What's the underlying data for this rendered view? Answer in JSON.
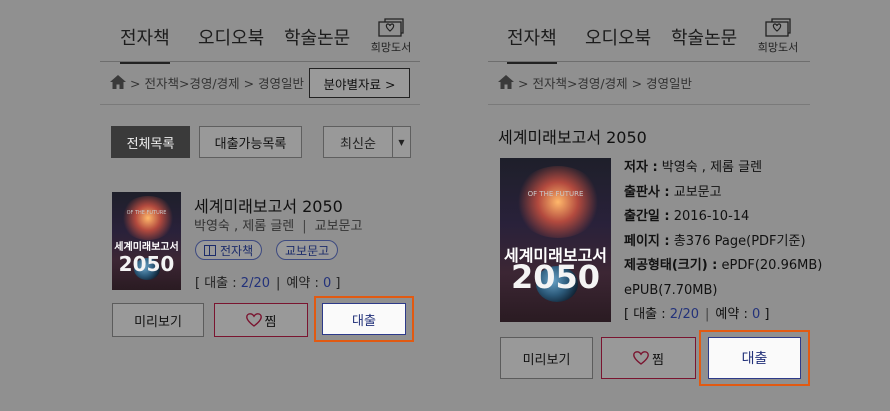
{
  "tabs": [
    "전자책",
    "오디오북",
    "학술논문"
  ],
  "wishlist_label": "희망도서",
  "breadcrumb": [
    "전자책",
    "경영/경제",
    "경영일반"
  ],
  "breadcrumb_text": "> 전자책>경영/경제 > 경영일반",
  "field_button": "분야별자료 >",
  "list_filters": {
    "all": "전체목록",
    "available": "대출가능목록",
    "sort": "최신순"
  },
  "book": {
    "title": "세계미래보고서 2050",
    "authors": "박영숙 , 제롬 글렌",
    "publisher": "교보문고",
    "tag_type": "전자책",
    "tag_publisher": "교보문고",
    "loan_label": "대출 : ",
    "loan_value": "2/20",
    "reserve_label": "예약 : ",
    "reserve_value": "0",
    "pub_date": "2016-10-14",
    "pages": "총376 Page(PDF기준)",
    "format": "ePDF(20.96MB)",
    "format2": "ePUB(7.70MB)",
    "cover_title": "세계미래보고서",
    "cover_year": "2050",
    "cover_sub": "OF THE FUTURE"
  },
  "detail_labels": {
    "author": "저자 :",
    "publisher": "출판사 :",
    "date": "출간일 :",
    "pages": "페이지 :",
    "format": "제공형태(크기) :"
  },
  "actions": {
    "preview": "미리보기",
    "like": "찜",
    "loan": "대출"
  },
  "colors": {
    "overlay": "#909090",
    "accent": "#e25a12",
    "link": "#23327a",
    "like_border": "#7a1530"
  }
}
